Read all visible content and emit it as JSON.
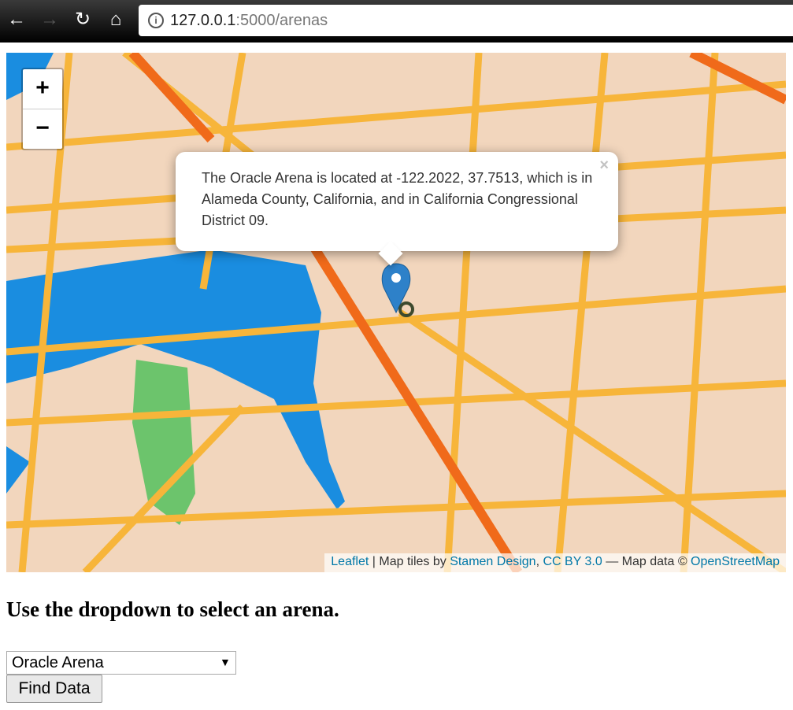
{
  "browser": {
    "url_host": "127.0.0.1",
    "url_rest": ":5000/arenas",
    "icons": [
      "back-icon",
      "forward-icon",
      "reload-icon",
      "home-icon",
      "info-icon"
    ]
  },
  "map": {
    "zoom_in": "+",
    "zoom_out": "−",
    "popup_text": "The Oracle Arena is located at -122.2022, 37.7513, which is in Alameda County, California, and in California Congressional District 09.",
    "popup_close": "×",
    "attribution": {
      "leaflet": "Leaflet",
      "sep1": " | Map tiles by ",
      "stamen": "Stamen Design",
      "comma": ", ",
      "cc": "CC BY 3.0",
      "sep2": " — Map data © ",
      "osm": "OpenStreetMap"
    },
    "colors": {
      "water": "#1a8de0",
      "park": "#6cc46c",
      "road": "#f7b53a",
      "highway": "#f06a1a",
      "land": "#f2d6bd",
      "link": "#0078a8"
    }
  },
  "heading": "Use the dropdown to select an arena.",
  "select": {
    "value": "Oracle Arena"
  },
  "find_button": "Find Data"
}
